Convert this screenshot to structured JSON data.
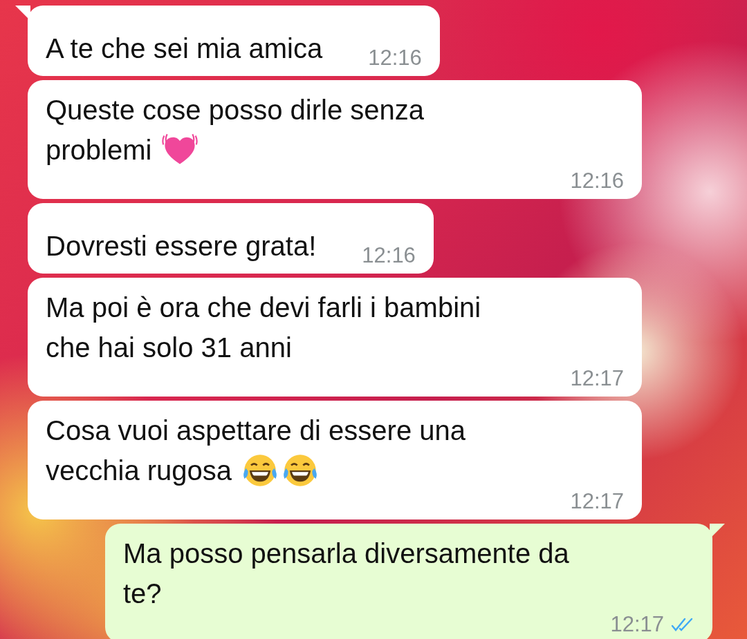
{
  "messages": [
    {
      "kind": "incoming",
      "tail": true,
      "lines": [
        "A te che sei mia amica"
      ],
      "time": "12:16"
    },
    {
      "kind": "incoming",
      "tail": false,
      "lines": [
        "Queste cose posso dirle senza",
        "problemi"
      ],
      "emojis": [
        {
          "kind": "heart"
        }
      ],
      "time": "12:16"
    },
    {
      "kind": "incoming",
      "tail": false,
      "lines": [
        "Dovresti essere grata!"
      ],
      "time": "12:16"
    },
    {
      "kind": "incoming",
      "tail": false,
      "lines": [
        "Ma poi è ora che devi farli i bambini",
        "che hai solo 31 anni"
      ],
      "time": "12:17"
    },
    {
      "kind": "incoming",
      "tail": false,
      "lines": [
        "Cosa vuoi aspettare di essere una",
        "vecchia rugosa"
      ],
      "emojis": [
        {
          "kind": "laughing"
        },
        {
          "kind": "laughing"
        }
      ],
      "time": "12:17"
    },
    {
      "kind": "outgoing",
      "tail": true,
      "lines": [
        "Ma posso pensarla diversamente da",
        "te?"
      ],
      "time": "12:17",
      "read": true
    }
  ]
}
